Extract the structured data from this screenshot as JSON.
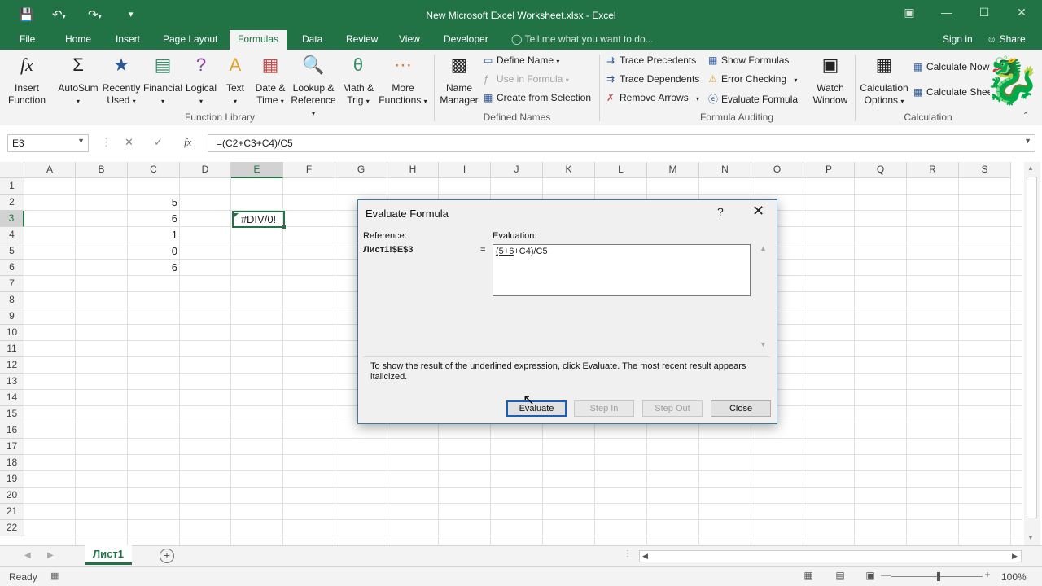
{
  "window": {
    "title": "New Microsoft Excel Worksheet.xlsx - Excel"
  },
  "tabs": [
    "File",
    "Home",
    "Insert",
    "Page Layout",
    "Formulas",
    "Data",
    "Review",
    "View",
    "Developer"
  ],
  "active_tab": "Formulas",
  "tell_me": "Tell me what you want to do...",
  "sign_in": "Sign in",
  "share": "Share",
  "ribbon": {
    "function_library": {
      "label": "Function Library",
      "insert_function": [
        "Insert",
        "Function"
      ],
      "autosum": "AutoSum",
      "recently_used": [
        "Recently",
        "Used"
      ],
      "financial": "Financial",
      "logical": "Logical",
      "text": "Text",
      "date_time": [
        "Date &",
        "Time"
      ],
      "lookup_reference": [
        "Lookup &",
        "Reference"
      ],
      "math_trig": [
        "Math &",
        "Trig"
      ],
      "more_functions": [
        "More",
        "Functions"
      ]
    },
    "defined_names": {
      "label": "Defined Names",
      "name_manager": [
        "Name",
        "Manager"
      ],
      "define_name": "Define Name",
      "use_in_formula": "Use in Formula",
      "create_from_selection": "Create from Selection"
    },
    "formula_auditing": {
      "label": "Formula Auditing",
      "trace_precedents": "Trace Precedents",
      "trace_dependents": "Trace Dependents",
      "remove_arrows": "Remove Arrows",
      "show_formulas": "Show Formulas",
      "error_checking": "Error Checking",
      "evaluate_formula": "Evaluate Formula",
      "watch_window": [
        "Watch",
        "Window"
      ]
    },
    "calculation": {
      "label": "Calculation",
      "calculation_options": [
        "Calculation",
        "Options"
      ],
      "calculate_now": "Calculate Now",
      "calculate_sheet": "Calculate Shee"
    }
  },
  "formula_bar": {
    "name_box": "E3",
    "formula": "=(C2+C3+C4)/C5"
  },
  "grid": {
    "columns": [
      "A",
      "B",
      "C",
      "D",
      "E",
      "F",
      "G",
      "H",
      "I",
      "J",
      "K",
      "L",
      "M",
      "N",
      "O",
      "P",
      "Q",
      "R",
      "S"
    ],
    "rows": [
      "1",
      "2",
      "3",
      "4",
      "5",
      "6",
      "7",
      "8",
      "9",
      "10",
      "11",
      "12",
      "13",
      "14",
      "15",
      "16",
      "17",
      "18",
      "19",
      "20",
      "21",
      "22"
    ],
    "selected_column": "E",
    "selected_row": "3",
    "cells": {
      "C2": "5",
      "C3": "6",
      "C4": "1",
      "C5": "0",
      "C6": "6",
      "E3": "#DIV/0!"
    }
  },
  "sheet_tab": "Лист1",
  "status": {
    "ready": "Ready",
    "zoom": "100%"
  },
  "dialog": {
    "title": "Evaluate Formula",
    "reference_label": "Reference:",
    "evaluation_label": "Evaluation:",
    "reference": "Лист1!$E$3",
    "eq": "=",
    "evaluation_underlined": "(5+6",
    "evaluation_rest": "+C4)/C5",
    "help_text": "To show the result of the underlined expression, click Evaluate.  The most recent result appears italicized.",
    "buttons": {
      "evaluate": "Evaluate",
      "step_in": "Step In",
      "step_out": "Step Out",
      "close": "Close"
    }
  },
  "colors": {
    "excel_green": "#217346",
    "ribbon_bg": "#f3f3f3",
    "grid_line": "#e1e1e1"
  }
}
